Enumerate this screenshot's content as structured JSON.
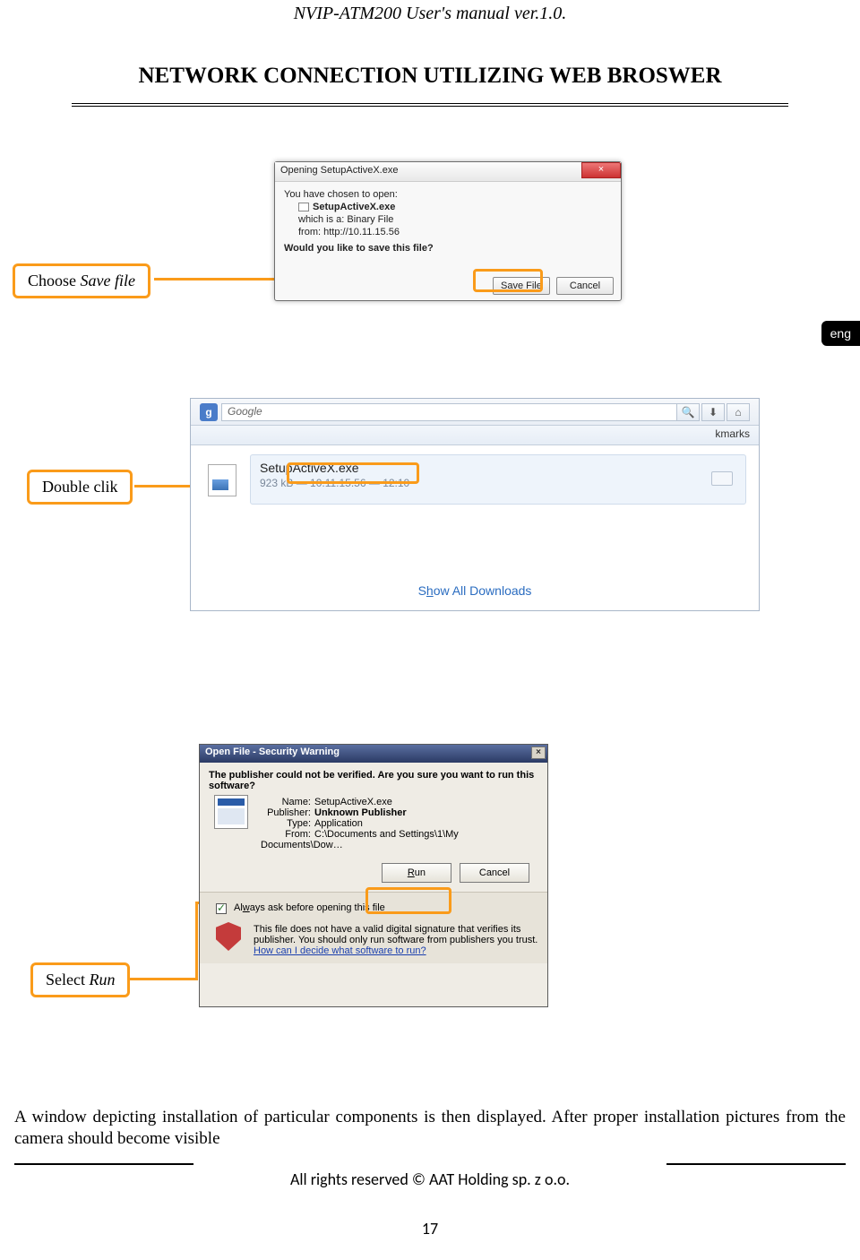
{
  "doc": {
    "header": "NVIP-ATM200 User's manual ver.1.0.",
    "title": "NETWORK CONNECTION UTILIZING WEB BROSWER",
    "lang_tab": "eng",
    "body_text": "A window depicting installation of particular components is then displayed. After proper installation pictures from the camera should become visible",
    "footer": "All rights reserved © AAT Holding sp. z o.o.",
    "page": "17"
  },
  "callouts": {
    "c1_pre": "Choose ",
    "c1_ital": "Save file",
    "c2": "Double clik",
    "c3_pre": "Select ",
    "c3_ital": "Run"
  },
  "dlg1": {
    "title": "Opening SetupActiveX.exe",
    "close": "×",
    "line1": "You have chosen to open:",
    "file": "SetupActiveX.exe",
    "which_label": "which is a:",
    "which_val": "Binary File",
    "from_label": "from:",
    "from_val": "http://10.11.15.56",
    "prompt": "Would you like to save this file?",
    "save": "Save File",
    "cancel": "Cancel"
  },
  "dl": {
    "glogo": "g",
    "search_placeholder": "Google",
    "search_icon": "🔍",
    "down_icon": "⬇",
    "home_icon": "⌂",
    "bookmarks": "kmarks",
    "name": "SetupActiveX.exe",
    "meta": "923 kB — 10.11.15.56 — 12:10",
    "showall_pre": "S",
    "showall_u": "h",
    "showall_post": "ow All Downloads"
  },
  "dlg3": {
    "title": "Open File - Security Warning",
    "x": "×",
    "msg": "The publisher could not be verified.  Are you sure you want to run this software?",
    "name_l": "Name:",
    "name_v": "SetupActiveX.exe",
    "pub_l": "Publisher:",
    "pub_v": "Unknown Publisher",
    "type_l": "Type:",
    "type_v": "Application",
    "from_l": "From:",
    "from_v": "C:\\Documents and Settings\\1\\My Documents\\Dow…",
    "run_u": "R",
    "run_post": "un",
    "cancel": "Cancel",
    "always_pre": "Al",
    "always_u": "w",
    "always_post": "ays ask before opening this file",
    "warn1": "This file does not have a valid digital signature that verifies its publisher.  You should only run software from publishers you trust.",
    "warn_link": "How can I decide what software to run?"
  }
}
